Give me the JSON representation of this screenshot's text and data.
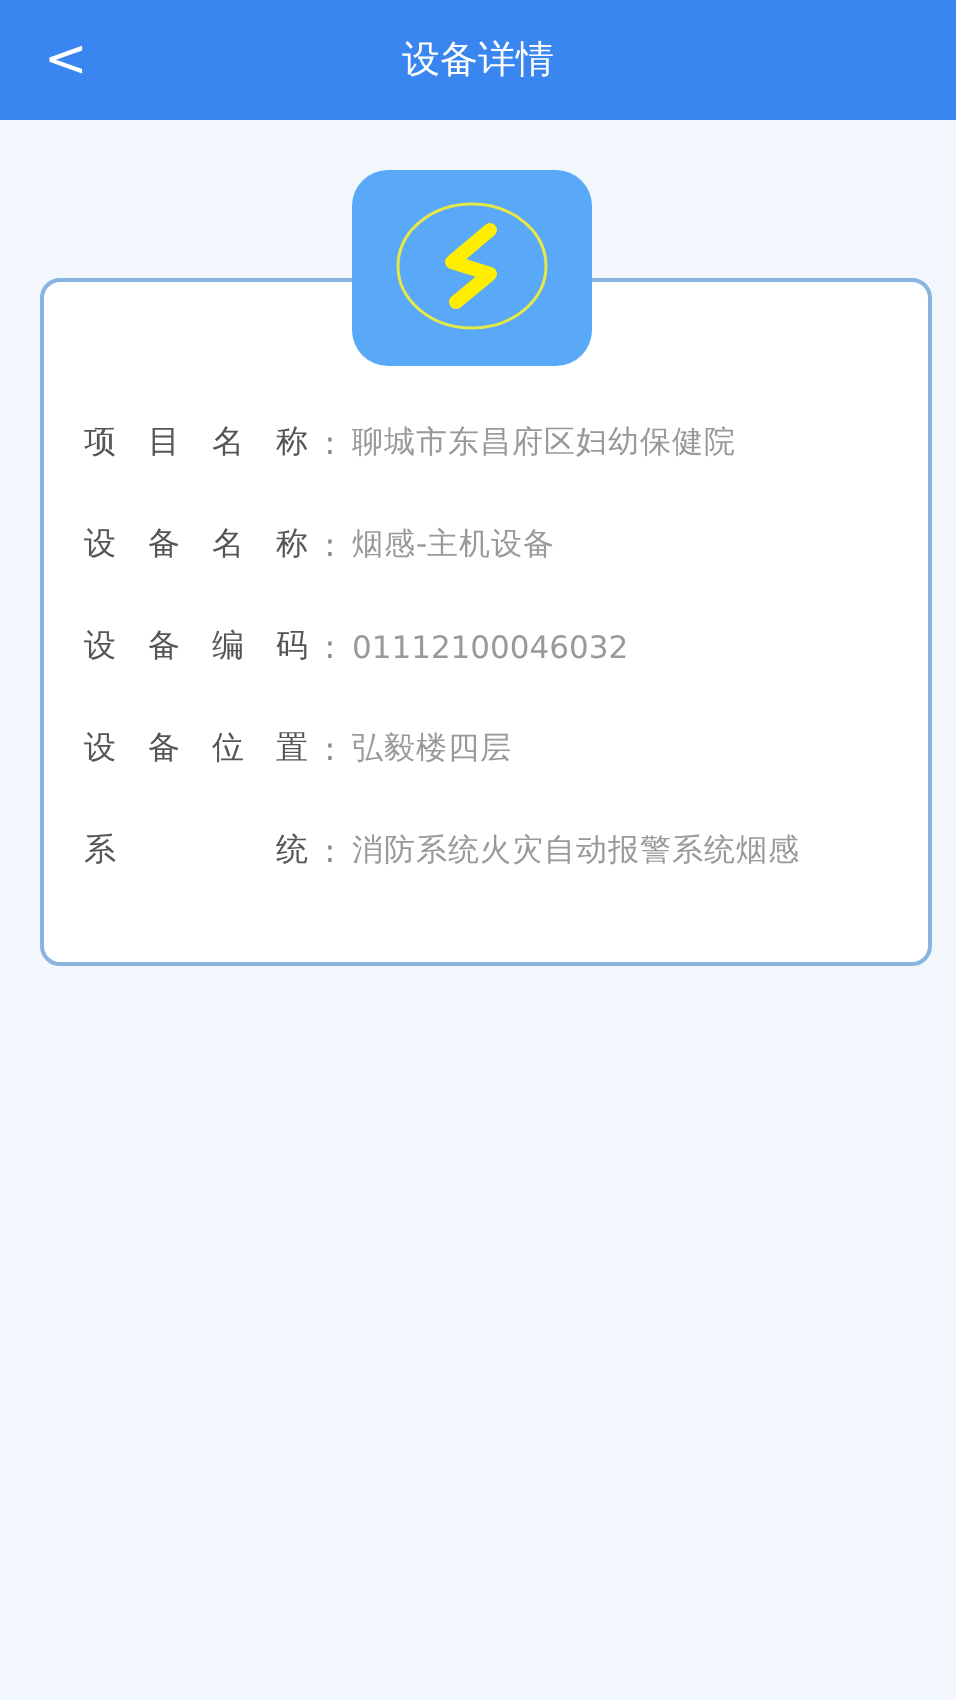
{
  "header": {
    "back": "<",
    "title": "设备详情"
  },
  "details": [
    {
      "label": "项目名称",
      "colon": ":",
      "value": "聊城市东昌府区妇幼保健院"
    },
    {
      "label": "设备名称",
      "colon": ":",
      "value": "烟感-主机设备"
    },
    {
      "label": "设备编码",
      "colon": ":",
      "value": "01112100046032"
    },
    {
      "label": "设备位置",
      "colon": ":",
      "value": "弘毅楼四层"
    },
    {
      "label": "系统",
      "colon": ":",
      "value": "消防系统火灾自动报警系统烟感"
    }
  ]
}
